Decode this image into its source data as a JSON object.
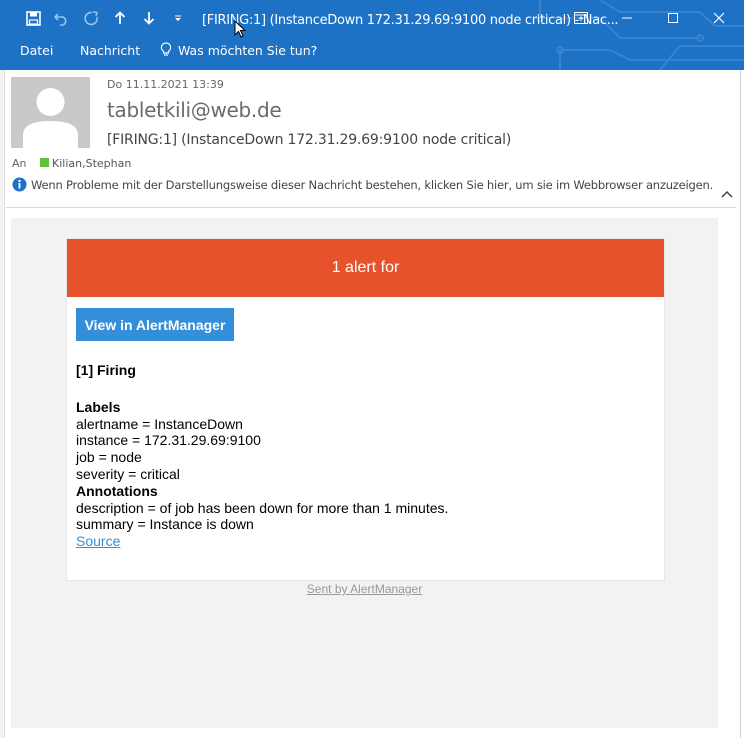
{
  "window": {
    "title": "[FIRING:1]  (InstanceDown 172.31.29.69:9100 node critical) - Nac...",
    "quick_access": [
      "save-icon",
      "undo-icon",
      "redo-icon",
      "up-arrow-icon",
      "down-arrow-icon",
      "customize-icon"
    ],
    "controls": [
      "restore-ribbon-icon",
      "minimize-icon",
      "maximize-icon",
      "close-icon"
    ],
    "accent": "#1e72c6"
  },
  "ribbon": {
    "file": "Datei",
    "message": "Nachricht",
    "tell_me": "Was möchten Sie tun?"
  },
  "header": {
    "date": "Do 11.11.2021 13:39",
    "from": "tabletkili@web.de",
    "subject": "[FIRING:1]  (InstanceDown 172.31.29.69:9100 node critical)",
    "to_label": "An",
    "recipient": "Kilian,Stephan",
    "info": "Wenn Probleme mit der Darstellungsweise dieser Nachricht bestehen, klicken Sie hier, um sie im Webbrowser anzuzeigen."
  },
  "email": {
    "banner": "1 alert for",
    "banner_color": "#e6522c",
    "button": "View in AlertManager",
    "button_color": "#348eda",
    "firing": "[1] Firing",
    "labels_title": "Labels",
    "labels": [
      "alertname = InstanceDown",
      "instance = 172.31.29.69:9100",
      "job = node",
      "severity = critical"
    ],
    "annotations_title": "Annotations",
    "annotations": [
      "description = of job has been down for more than 1 minutes.",
      "summary = Instance is down"
    ],
    "source": "Source",
    "footer": "Sent by AlertManager"
  }
}
